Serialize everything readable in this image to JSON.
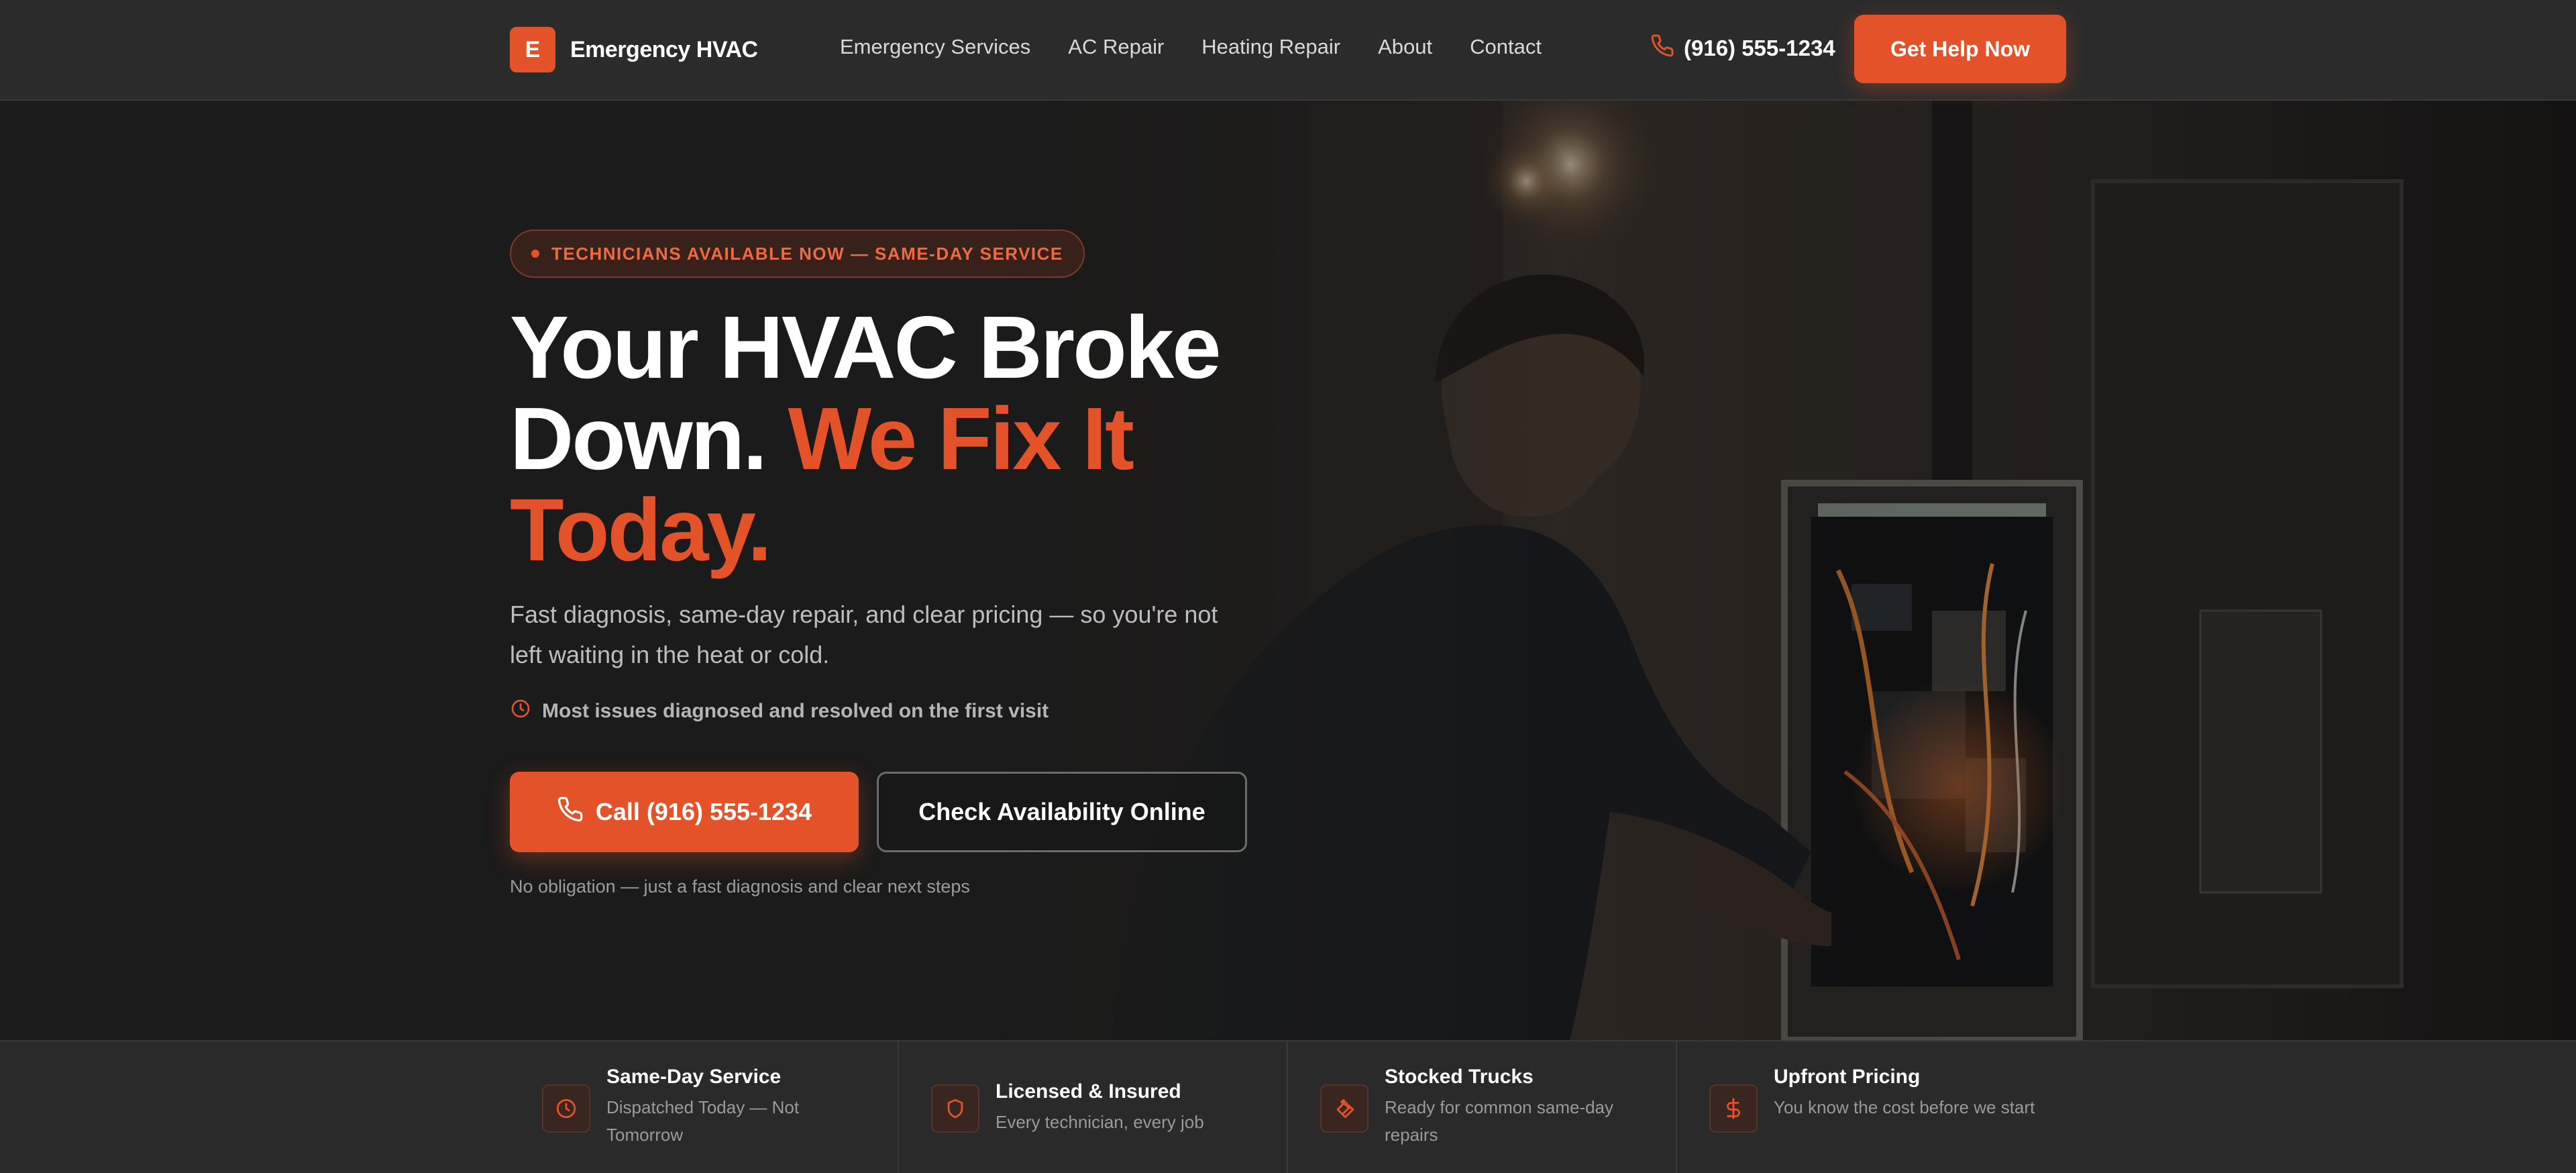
{
  "brand": {
    "mark": "E",
    "name": "Emergency HVAC"
  },
  "nav": {
    "links": [
      "Emergency Services",
      "AC Repair",
      "Heating Repair",
      "About",
      "Contact"
    ],
    "phone": "(916) 555-1234",
    "cta": "Get Help Now"
  },
  "hero": {
    "badge": "TECHNICIANS AVAILABLE NOW — SAME-DAY SERVICE",
    "headline_plain": "Your HVAC Broke Down.",
    "headline_accent": "We Fix It Today.",
    "subhead": "Fast diagnosis, same-day repair, and clear pricing — so you're not left waiting in the heat or cold.",
    "note": "Most issues diagnosed and resolved on the first visit",
    "primary_button": "Call (916) 555-1234",
    "secondary_button": "Check Availability Online",
    "fineprint": "No obligation — just a fast diagnosis and clear next steps"
  },
  "features": [
    {
      "icon": "clock-icon",
      "title": "Same-Day Service",
      "desc": "Dispatched Today — Not Tomorrow"
    },
    {
      "icon": "shield-icon",
      "title": "Licensed & Insured",
      "desc": "Every technician, every job"
    },
    {
      "icon": "wrench-icon",
      "title": "Stocked Trucks",
      "desc": "Ready for common same-day repairs"
    },
    {
      "icon": "dollar-icon",
      "title": "Upfront Pricing",
      "desc": "You know the cost before we start"
    }
  ],
  "colors": {
    "accent": "#e4522a",
    "background": "#1c1c1c",
    "nav": "#2b2b2b",
    "features_bar": "#2a2a2a"
  }
}
